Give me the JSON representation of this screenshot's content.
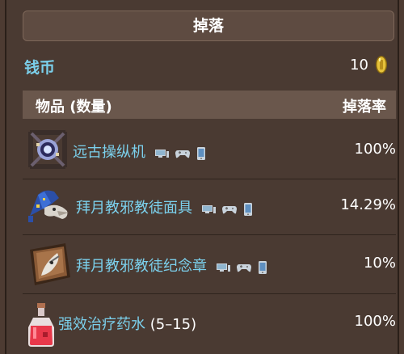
{
  "title": "掉落",
  "coins": {
    "label": "钱币",
    "value": "10"
  },
  "table": {
    "header_item": "物品 (数量)",
    "header_rate": "掉落率",
    "rows": [
      {
        "name": "远古操纵机",
        "qty": "",
        "rate": "100%",
        "icon": "ancient-manipulator-icon",
        "platforms": true
      },
      {
        "name": "拜月教邪教徒面具",
        "qty": "",
        "rate": "14.29%",
        "icon": "lunatic-cultist-mask-icon",
        "platforms": true
      },
      {
        "name": "拜月教邪教徒纪念章",
        "qty": "",
        "rate": "10%",
        "icon": "lunatic-cultist-relic-icon",
        "platforms": true
      },
      {
        "name": "强效治疗药水",
        "qty": "(5–15)",
        "rate": "100%",
        "icon": "greater-healing-potion-icon",
        "platforms": false
      }
    ]
  },
  "colors": {
    "link": "#7bd0ec",
    "background": "#4a3a32",
    "header_bg": "#6a574c"
  }
}
